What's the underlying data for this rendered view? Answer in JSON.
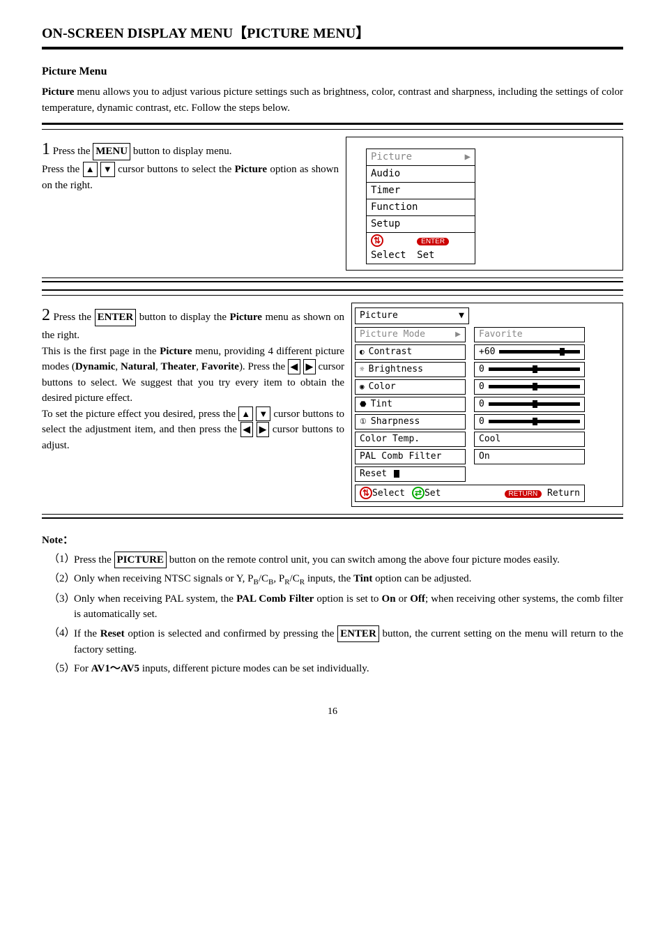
{
  "title": "ON-SCREEN DISPLAY MENU【PICTURE MENU】",
  "section_heading": "Picture Menu",
  "intro": "Picture menu allows you to adjust various picture settings such as brightness, color, contrast and sharpness, including the settings of color temperature, dynamic contrast, etc. Follow the steps below.",
  "step1": {
    "num": "1",
    "text_a": " Press the ",
    "menu_btn": "MENU",
    "text_b": " button to display menu.",
    "text_c": "Press the ",
    "text_d": " cursor buttons to select the ",
    "picture_word": "Picture",
    "text_e": " option as shown on the right.",
    "menu": {
      "items": [
        "Picture",
        "Audio",
        "Timer",
        "Function",
        "Setup"
      ],
      "select_label": "Select",
      "enter_badge": "ENTER",
      "set_label": "Set"
    }
  },
  "step2": {
    "num": "2",
    "text_a": " Press the ",
    "enter_btn": "ENTER",
    "text_b": " button to display the ",
    "picture_word": "Picture",
    "text_c": " menu as shown on the right.",
    "para2_a": "This is the first page in the ",
    "para2_b": " menu, providing 4 different picture modes (",
    "modes": [
      "Dynamic",
      "Natural",
      "Theater",
      "Favorite"
    ],
    "para2_c": "). Press the ",
    "para2_d": " cursor buttons to select. We suggest that you try every item to obtain the desired picture effect.",
    "para3_a": "To set the picture effect you desired, press the ",
    "para3_b": " cursor buttons to select the adjustment item, and then press the ",
    "para3_c": " cursor buttons to adjust.",
    "panel": {
      "header": "Picture",
      "rows": [
        {
          "label": "Picture Mode",
          "value": "Favorite",
          "grayed": true
        },
        {
          "label": "Contrast",
          "value": "+60"
        },
        {
          "label": "Brightness",
          "value": "0"
        },
        {
          "label": "Color",
          "value": "0"
        },
        {
          "label": "Tint",
          "value": "0"
        },
        {
          "label": "Sharpness",
          "value": "0"
        },
        {
          "label": "Color Temp.",
          "value": "Cool"
        },
        {
          "label": "PAL Comb Filter",
          "value": "On"
        },
        {
          "label": "Reset",
          "value": ""
        }
      ],
      "footer": {
        "select": "Select",
        "set": "Set",
        "return_badge": "RETURN",
        "return": "Return"
      }
    }
  },
  "notes": {
    "heading": "Note：",
    "items": [
      {
        "num": "（1）",
        "pre": "Press the ",
        "boxed": "PICTURE",
        "post": " button on the remote control unit, you can switch among the above four picture modes easily."
      },
      {
        "num": "（2）",
        "text": "Only when receiving NTSC signals or Y, PB/CB, PR/CR inputs, the Tint option can be adjusted.",
        "bold_words": [
          "Tint"
        ]
      },
      {
        "num": "（3）",
        "text": "Only when receiving PAL system, the PAL Comb Filter option is set to On or Off; when receiving other systems, the comb filter is automatically set.",
        "bold_words": [
          "PAL Comb Filter",
          "On",
          "Off"
        ]
      },
      {
        "num": "（4）",
        "pre": "If the ",
        "bold1": "Reset",
        "mid": " option is selected and confirmed by pressing the ",
        "boxed": "ENTER",
        "post": " button, the current setting on the menu will return to the factory setting."
      },
      {
        "num": "（5）",
        "pre": "For ",
        "bold1": "AV1～AV5",
        "post": " inputs, different picture modes can be set individually."
      }
    ]
  },
  "page_number": "16"
}
